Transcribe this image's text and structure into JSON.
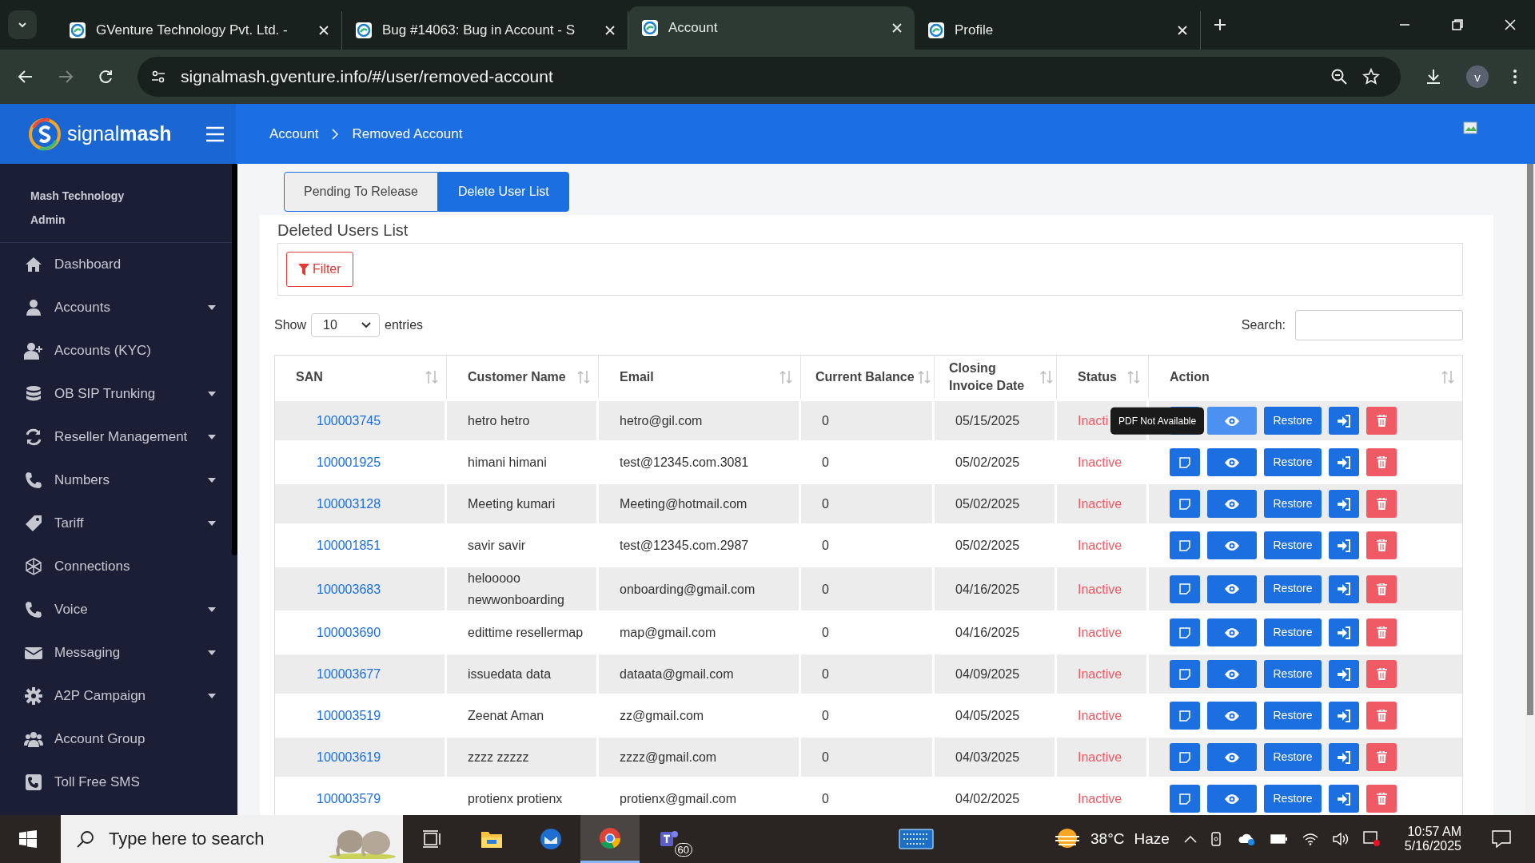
{
  "browser": {
    "tabs": [
      {
        "title": "GVenture Technology Pvt. Ltd. -",
        "selected": false
      },
      {
        "title": "Bug #14063: Bug in Account - S",
        "selected": false
      },
      {
        "title": "Account",
        "selected": true
      },
      {
        "title": "Profile",
        "selected": false
      }
    ],
    "url": "signalmash.gventure.info/#/user/removed-account",
    "profile_initial": "v"
  },
  "header": {
    "logo": "signal**mash**",
    "breadcrumb": [
      "Account",
      "Removed Account"
    ]
  },
  "sidebar": {
    "org": "Mash Technology",
    "role": "Admin",
    "items": [
      {
        "label": "Dashboard",
        "expandable": false
      },
      {
        "label": "Accounts",
        "expandable": true
      },
      {
        "label": "Accounts (KYC)",
        "expandable": false
      },
      {
        "label": "OB SIP Trunking",
        "expandable": true
      },
      {
        "label": "Reseller Management",
        "expandable": true
      },
      {
        "label": "Numbers",
        "expandable": true
      },
      {
        "label": "Tariff",
        "expandable": true
      },
      {
        "label": "Connections",
        "expandable": false
      },
      {
        "label": "Voice",
        "expandable": true
      },
      {
        "label": "Messaging",
        "expandable": true
      },
      {
        "label": "A2P Campaign",
        "expandable": true
      },
      {
        "label": "Account Group",
        "expandable": false
      },
      {
        "label": "Toll Free SMS",
        "expandable": false
      }
    ]
  },
  "tabs": [
    {
      "label": "Pending To Release",
      "selected": false
    },
    {
      "label": "Delete User List",
      "selected": true
    }
  ],
  "card": {
    "title": "Deleted Users List",
    "filter_button": "Filter",
    "show_label": "Show",
    "page_size": "10",
    "entries_label": "entries",
    "search_label": "Search:"
  },
  "table": {
    "columns": [
      "SAN",
      "Customer Name",
      "Email",
      "Current Balance",
      "Closing Invoice Date",
      "Status",
      "Action"
    ],
    "tooltip": "PDF Not Available",
    "rows": [
      {
        "san": "100003745",
        "customer_name": "hetro hetro",
        "email": "hetro@gil.com",
        "balance": "0",
        "closing_date": "05/15/2025",
        "status": "Inacti",
        "tooltip": true,
        "restore": "Restore"
      },
      {
        "san": "100001925",
        "customer_name": "himani himani",
        "email": "test@12345.com.3081",
        "balance": "0",
        "closing_date": "05/02/2025",
        "status": "Inactive",
        "tooltip": false,
        "restore": "Restore"
      },
      {
        "san": "100003128",
        "customer_name": "Meeting kumari",
        "email": "Meeting@hotmail.com",
        "balance": "0",
        "closing_date": "05/02/2025",
        "status": "Inactive",
        "tooltip": false,
        "restore": "Restore"
      },
      {
        "san": "100001851",
        "customer_name": "savir savir",
        "email": "test@12345.com.2987",
        "balance": "0",
        "closing_date": "05/02/2025",
        "status": "Inactive",
        "tooltip": false,
        "restore": "Restore"
      },
      {
        "san": "100003683",
        "customer_name": "helooooo newwonboarding",
        "email": "onboarding@gmail.com",
        "balance": "0",
        "closing_date": "04/16/2025",
        "status": "Inactive",
        "tooltip": false,
        "restore": "Restore"
      },
      {
        "san": "100003690",
        "customer_name": "edittime resellermap",
        "email": "map@gmail.com",
        "balance": "0",
        "closing_date": "04/16/2025",
        "status": "Inactive",
        "tooltip": false,
        "restore": "Restore"
      },
      {
        "san": "100003677",
        "customer_name": "issuedata data",
        "email": "dataata@gmail.com",
        "balance": "0",
        "closing_date": "04/09/2025",
        "status": "Inactive",
        "tooltip": false,
        "restore": "Restore"
      },
      {
        "san": "100003519",
        "customer_name": "Zeenat Aman",
        "email": "zz@gmail.com",
        "balance": "0",
        "closing_date": "04/05/2025",
        "status": "Inactive",
        "tooltip": false,
        "restore": "Restore"
      },
      {
        "san": "100003619",
        "customer_name": "zzzz zzzzz",
        "email": "zzzz@gmail.com",
        "balance": "0",
        "closing_date": "04/03/2025",
        "status": "Inactive",
        "tooltip": false,
        "restore": "Restore"
      },
      {
        "san": "100003579",
        "customer_name": "protienx protienx",
        "email": "protienx@gmail.com",
        "balance": "0",
        "closing_date": "04/02/2025",
        "status": "Inactive",
        "tooltip": false,
        "restore": "Restore"
      }
    ]
  },
  "taskbar": {
    "search_placeholder": "Type here to search",
    "apps": [
      {
        "kind": "taskview",
        "active": false
      },
      {
        "kind": "explorer",
        "active": false
      },
      {
        "kind": "mail",
        "active": false
      },
      {
        "kind": "chrome",
        "active": true
      },
      {
        "kind": "teams",
        "active": false,
        "badge": "60"
      }
    ],
    "temperature": "38°C",
    "weather": "Haze",
    "time": "10:57 AM",
    "date": "5/16/2025"
  }
}
